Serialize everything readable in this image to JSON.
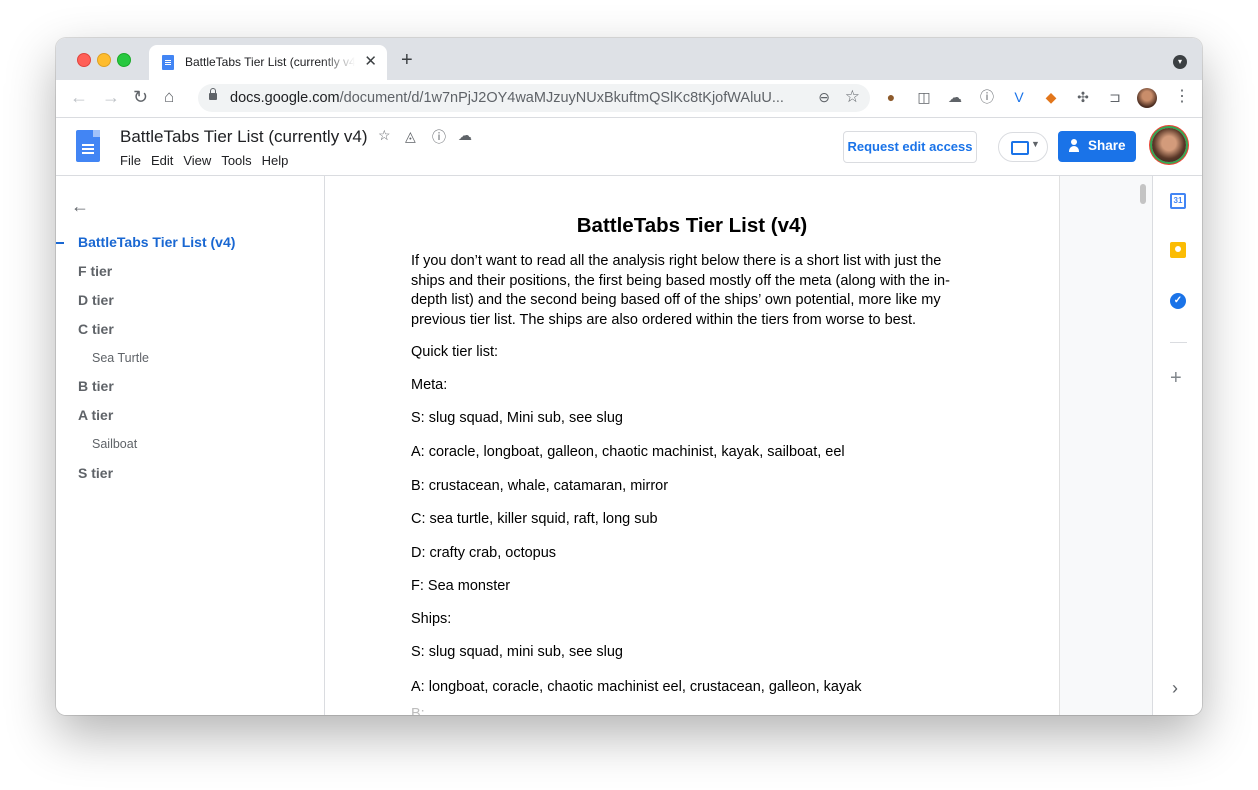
{
  "browser": {
    "tab_title": "BattleTabs Tier List (currently v4)",
    "tab_close": "✕",
    "new_tab": "+",
    "url_host": "docs.google.com",
    "url_path": "/document/d/1w7nPjJ2OY4waMJzuyNUxBkuftmQSlKc8tKjofWAluU..."
  },
  "docs": {
    "title": "BattleTabs Tier List (currently v4)",
    "menu": [
      "File",
      "Edit",
      "View",
      "Tools",
      "Help"
    ],
    "request_edit_label": "Request edit access",
    "share_label": "Share"
  },
  "outline": {
    "items": [
      {
        "label": "BattleTabs Tier List (v4)",
        "level": 1,
        "active": true
      },
      {
        "label": "F tier",
        "level": 1
      },
      {
        "label": "D tier",
        "level": 1
      },
      {
        "label": "C tier",
        "level": 1
      },
      {
        "label": "Sea Turtle",
        "level": 2
      },
      {
        "label": "B tier",
        "level": 1
      },
      {
        "label": "A tier",
        "level": 1
      },
      {
        "label": "Sailboat",
        "level": 2
      },
      {
        "label": "S tier",
        "level": 1
      }
    ]
  },
  "document": {
    "heading": "BattleTabs Tier List (v4)",
    "paragraphs": [
      "If you don’t want to read all the analysis right below there is a short list with just the ships and their positions, the first being based mostly off the meta (along with the in-depth list) and the second being based off of the ships’ own potential, more like my previous tier list. The ships are also ordered within the tiers from worse to best.",
      "Quick tier list:",
      "Meta:",
      "S: slug squad, Mini sub, see slug",
      "A: coracle, longboat, galleon, chaotic machinist, kayak, sailboat, eel",
      "B: crustacean, whale, catamaran, mirror",
      "C: sea turtle, killer squid, raft, long sub",
      "D: crafty crab, octopus",
      "F: Sea monster",
      "Ships:",
      "S: slug squad, mini sub, see slug",
      "A: longboat, coracle, chaotic machinist eel, crustacean, galleon, kayak",
      "B: ..."
    ]
  },
  "side_panel": {
    "calendar_day": "31"
  }
}
